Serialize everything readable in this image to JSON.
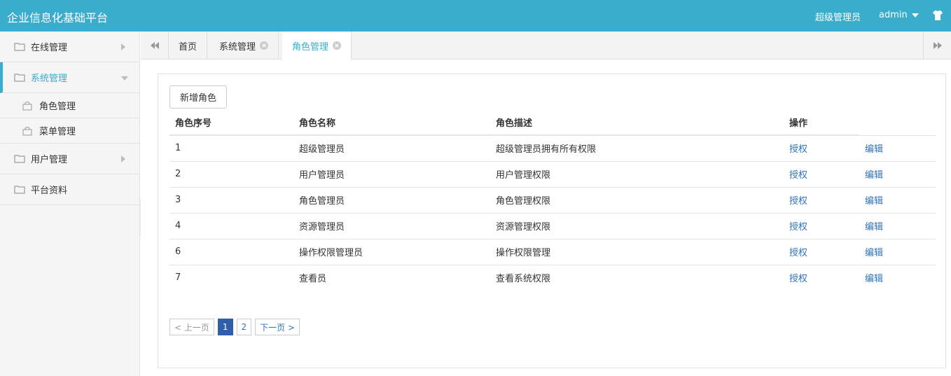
{
  "header": {
    "title": "企业信息化基础平台",
    "role": "超级管理员",
    "user": "admin"
  },
  "sidebar": {
    "items": [
      {
        "label": "在线管理"
      },
      {
        "label": "系统管理"
      },
      {
        "label": "角色管理"
      },
      {
        "label": "菜单管理"
      },
      {
        "label": "用户管理"
      },
      {
        "label": "平台资料"
      }
    ]
  },
  "tabs": [
    {
      "label": "首页"
    },
    {
      "label": "系统管理"
    },
    {
      "label": "角色管理"
    }
  ],
  "main": {
    "add_button": "新增角色",
    "columns": [
      "角色序号",
      "角色名称",
      "角色描述",
      "操作"
    ],
    "rows": [
      {
        "id": "1",
        "name": "超级管理员",
        "desc": "超级管理员拥有所有权限",
        "auth": "授权",
        "edit": "编辑"
      },
      {
        "id": "2",
        "name": "用户管理员",
        "desc": "用户管理权限",
        "auth": "授权",
        "edit": "编辑"
      },
      {
        "id": "3",
        "name": "角色管理员",
        "desc": "角色管理权限",
        "auth": "授权",
        "edit": "编辑"
      },
      {
        "id": "4",
        "name": "资源管理员",
        "desc": "资源管理权限",
        "auth": "授权",
        "edit": "编辑"
      },
      {
        "id": "6",
        "name": "操作权限管理员",
        "desc": "操作权限管理",
        "auth": "授权",
        "edit": "编辑"
      },
      {
        "id": "7",
        "name": "查看员",
        "desc": "查看系统权限",
        "auth": "授权",
        "edit": "编辑"
      }
    ],
    "pager": {
      "prev": "< 上一页",
      "pages": [
        "1",
        "2"
      ],
      "next": "下一页 >"
    }
  },
  "colors": {
    "header_bg": "#3aaccc",
    "accent": "#3aaccc",
    "link": "#2f73b8",
    "current_page": "#2f5fa8"
  }
}
